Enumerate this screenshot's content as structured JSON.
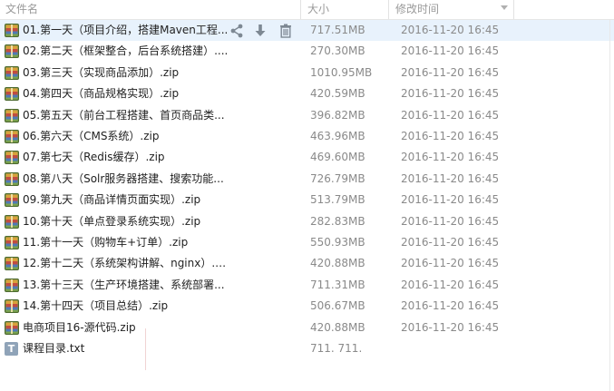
{
  "columns": {
    "name": "文件名",
    "size": "大小",
    "modified": "修改时间"
  },
  "rows": [
    {
      "name": "01.第一天（项目介绍，搭建Maven工程...",
      "size": "717.51MB",
      "date": "2016-11-20 16:45",
      "icon": "archive-icon"
    },
    {
      "name": "02.第二天（框架整合，后台系统搭建）....",
      "size": "270.30MB",
      "date": "2016-11-20 16:45",
      "icon": "archive-icon"
    },
    {
      "name": "03.第三天（实现商品添加）.zip",
      "size": "1010.95MB",
      "date": "2016-11-20 16:45",
      "icon": "archive-icon"
    },
    {
      "name": "04.第四天（商品规格实现）.zip",
      "size": "420.59MB",
      "date": "2016-11-20 16:45",
      "icon": "archive-icon"
    },
    {
      "name": "05.第五天（前台工程搭建、首页商品类...",
      "size": "396.82MB",
      "date": "2016-11-20 16:45",
      "icon": "archive-icon"
    },
    {
      "name": "06.第六天（CMS系统）.zip",
      "size": "463.96MB",
      "date": "2016-11-20 16:45",
      "icon": "archive-icon"
    },
    {
      "name": "07.第七天（Redis缓存）.zip",
      "size": "469.60MB",
      "date": "2016-11-20 16:45",
      "icon": "archive-icon"
    },
    {
      "name": "08.第八天（Solr服务器搭建、搜索功能...",
      "size": "726.79MB",
      "date": "2016-11-20 16:45",
      "icon": "archive-icon"
    },
    {
      "name": "09.第九天（商品详情页面实现）.zip",
      "size": "513.79MB",
      "date": "2016-11-20 16:45",
      "icon": "archive-icon"
    },
    {
      "name": "10.第十天（单点登录系统实现）.zip",
      "size": "282.83MB",
      "date": "2016-11-20 16:45",
      "icon": "archive-icon"
    },
    {
      "name": "11.第十一天（购物车+订单）.zip",
      "size": "550.93MB",
      "date": "2016-11-20 16:45",
      "icon": "archive-icon"
    },
    {
      "name": "12.第十二天（系统架构讲解、nginx）.zip",
      "size": "420.88MB",
      "date": "2016-11-20 16:45",
      "icon": "archive-icon"
    },
    {
      "name": "13.第十三天（生产环境搭建、系统部署...",
      "size": "711.31MB",
      "date": "2016-11-20 16:45",
      "icon": "archive-icon"
    },
    {
      "name": "14.第十四天（项目总结）.zip",
      "size": "506.67MB",
      "date": "2016-11-20 16:45",
      "icon": "archive-icon"
    },
    {
      "name": "电商项目16-源代码.zip",
      "size": "420.88MB",
      "date": "2016-11-20 16:45",
      "icon": "archive-icon"
    },
    {
      "name": "课程目录.txt",
      "size": "711. 711.",
      "date": "",
      "icon": "text-file-icon"
    }
  ],
  "row_actions": [
    "share-icon",
    "download-icon",
    "delete-icon"
  ],
  "txt_icon_letter": "T",
  "colors": {
    "selected_row": "#e8f2fc",
    "muted_text": "#8a8a8a",
    "header_text": "#9a9a9a"
  }
}
